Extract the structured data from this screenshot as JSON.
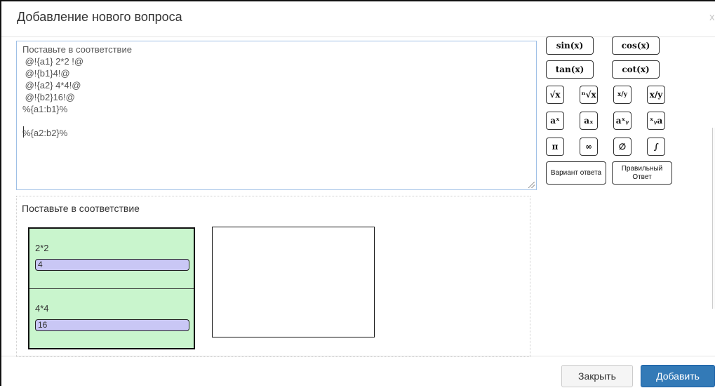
{
  "header": {
    "title": "Добавление нового вопроса",
    "close_glyph": "x"
  },
  "editor": {
    "lines": [
      "Поставьте в соответствие",
      " @!{a1} 2*2 !@",
      " @!{b1}4!@",
      " @!{a2} 4*4!@",
      " @!{b2}16!@",
      "%{a1:b1}%",
      "",
      "%{a2:b2}%"
    ]
  },
  "toolbar": {
    "sin": "sin(x)",
    "cos": "cos(x)",
    "tan": "tan(x)",
    "cot": "cot(x)",
    "sqrt": "√x",
    "nroot": "ⁿ√x",
    "frac": "x/y",
    "inline_frac": "x/y",
    "superscript": "aˣ",
    "subscript": "aₓ",
    "supsub": "aˣᵧ",
    "presupsub": "ˣᵧa",
    "pi": "π",
    "infinity": "∞",
    "empty_set": "∅",
    "integral": "∫",
    "answer_option": "Вариант ответа",
    "correct_answer": "Правильный Ответ"
  },
  "preview": {
    "title": "Поставьте в соответствие",
    "items": [
      {
        "question": "2*2",
        "answer": "4"
      },
      {
        "question": "4*4",
        "answer": "16"
      }
    ]
  },
  "footer": {
    "close_label": "Закрыть",
    "add_label": "Добавить"
  },
  "colors": {
    "matching_left_bg": "#c9f5cd",
    "answer_bg": "#c9c7f5",
    "primary_button": "#337ab7",
    "editor_border": "#9fc0e6"
  }
}
